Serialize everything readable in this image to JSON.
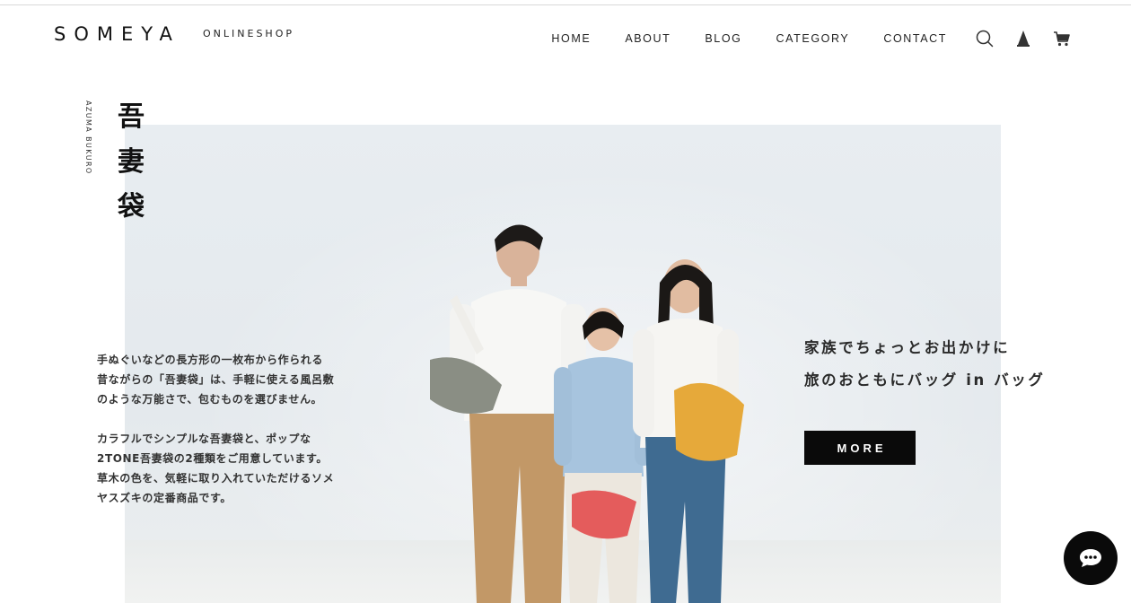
{
  "header": {
    "logo": "SOMEYA",
    "logo_sub": "ONLINESHOP",
    "nav": {
      "home": "HOME",
      "about": "ABOUT",
      "blog": "BLOG",
      "category": "CATEGORY",
      "contact": "CONTACT"
    },
    "icons": [
      "search-icon",
      "account-icon",
      "cart-icon"
    ]
  },
  "hero": {
    "vertical_en": "AZUMA BUKURO",
    "vertical_ja": [
      "吾",
      "妻",
      "袋"
    ],
    "description_p1": [
      "手ぬぐいなどの長方形の一枚布から作られる",
      "昔ながらの「吾妻袋」は、手軽に使える風呂敷",
      "のような万能さで、包むものを選びません。"
    ],
    "description_p2": [
      "カラフルでシンプルな吾妻袋と、ポップな",
      "2TONE吾妻袋の2種類をご用意しています。",
      "草木の色を、気軽に取り入れていただけるソメ",
      "ヤスズキの定番商品です。"
    ],
    "tagline": [
      "家族でちょっとお出かけに",
      "旅のおともにバッグ in バッグ"
    ],
    "more_label": "MORE"
  },
  "chat": {
    "icon": "chat-bubble-icon"
  },
  "colors": {
    "button": "#0a0a0a",
    "text": "#222222",
    "hero_bg": "#e6ebef"
  }
}
